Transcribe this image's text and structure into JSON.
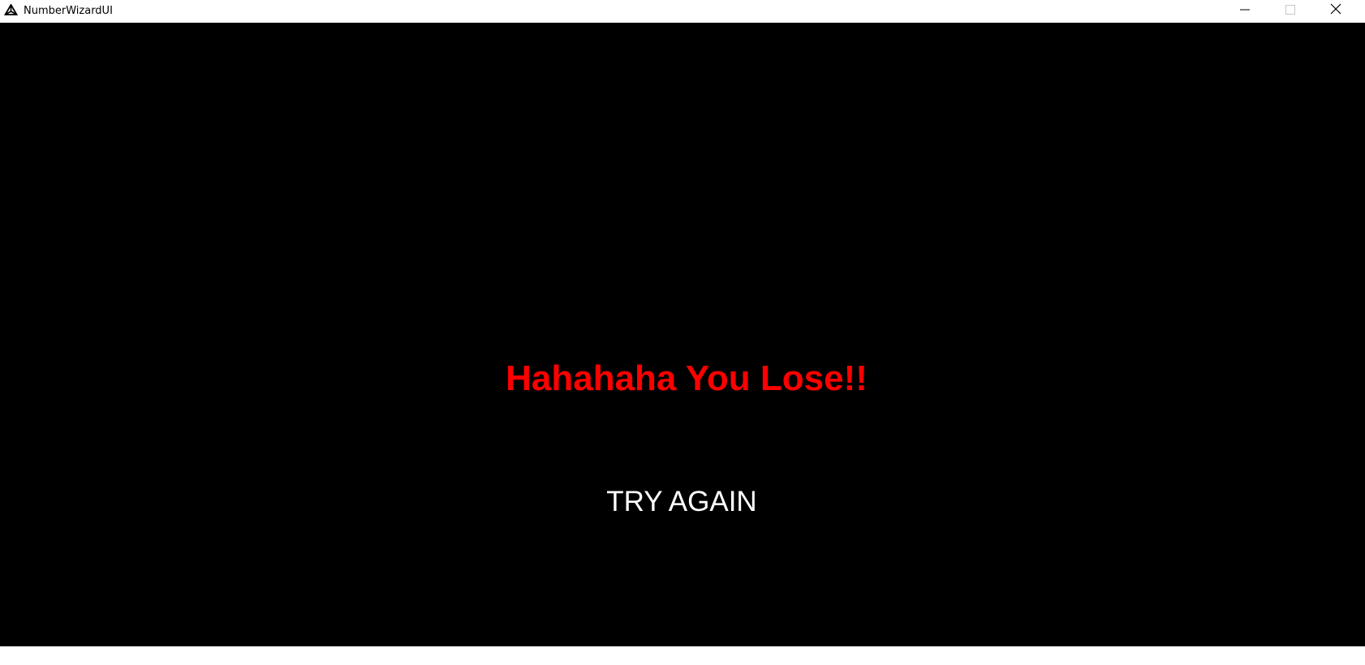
{
  "window": {
    "title": "NumberWizardUI",
    "icon": "unity-logo-icon",
    "controls": {
      "minimize_icon": "minimize-icon",
      "maximize_icon": "maximize-icon",
      "close_icon": "close-icon"
    }
  },
  "game": {
    "background_color": "#000000",
    "message": "Hahahaha You Lose!!",
    "message_color": "#ff0000",
    "button_label": "TRY AGAIN",
    "button_color": "#ffffff"
  }
}
